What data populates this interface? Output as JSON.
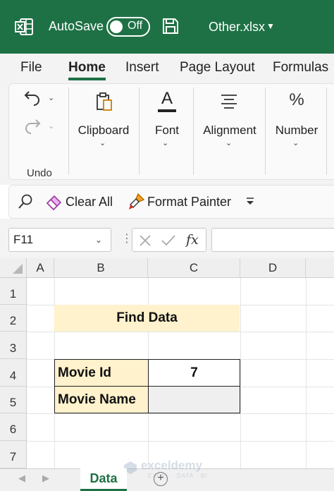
{
  "titlebar": {
    "autosave_label": "AutoSave",
    "autosave_state": "Off",
    "filename": "Other.xlsx"
  },
  "tabs": [
    "File",
    "Home",
    "Insert",
    "Page Layout",
    "Formulas"
  ],
  "ribbon": {
    "undo_group_label": "Undo",
    "clipboard_label": "Clipboard",
    "font_label": "Font",
    "alignment_label": "Alignment",
    "number_label": "Number",
    "font_icon_letter": "A",
    "number_icon_symbol": "%"
  },
  "quickbar": {
    "clear_all_label": "Clear All",
    "format_painter_label": "Format Painter"
  },
  "formula_bar": {
    "name_box_value": "F11",
    "fx_label": "fx",
    "formula_value": ""
  },
  "grid": {
    "columns": [
      "A",
      "B",
      "C",
      "D"
    ],
    "rows": [
      "1",
      "2",
      "3",
      "4",
      "5",
      "6",
      "7"
    ]
  },
  "sheet_content": {
    "title": "Find Data",
    "movie_id_label": "Movie Id",
    "movie_id_value": "7",
    "movie_name_label": "Movie Name",
    "movie_name_value": ""
  },
  "sheets": {
    "active": "Data"
  },
  "watermark": {
    "brand": "exceldemy",
    "tagline": "EXCEL · DATA · BI"
  },
  "colors": {
    "brand_green": "#1e7145",
    "title_fill": "#fff2cc"
  }
}
